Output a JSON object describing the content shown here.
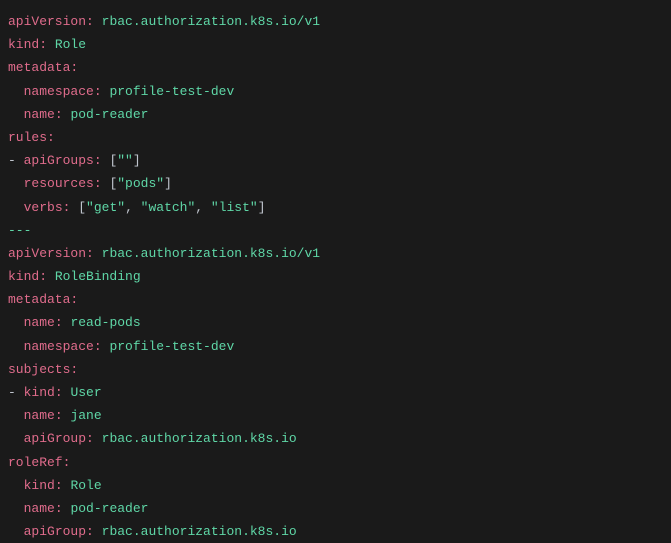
{
  "role": {
    "apiVersion_key": "apiVersion:",
    "apiVersion_val": "rbac.authorization.k8s.io/v1",
    "kind_key": "kind:",
    "kind_val": "Role",
    "metadata_key": "metadata:",
    "namespace_key": "namespace:",
    "namespace_val": "profile-test-dev",
    "name_key": "name:",
    "name_val": "pod-reader",
    "rules_key": "rules:",
    "apiGroups_key": "apiGroups:",
    "apiGroups_v0": "\"\"",
    "resources_key": "resources:",
    "resources_v0": "\"pods\"",
    "verbs_key": "verbs:",
    "verbs_v0": "\"get\"",
    "verbs_v1": "\"watch\"",
    "verbs_v2": "\"list\""
  },
  "sep": "---",
  "binding": {
    "apiVersion_key": "apiVersion:",
    "apiVersion_val": "rbac.authorization.k8s.io/v1",
    "kind_key": "kind:",
    "kind_val": "RoleBinding",
    "metadata_key": "metadata:",
    "name_key": "name:",
    "name_val": "read-pods",
    "namespace_key": "namespace:",
    "namespace_val": "profile-test-dev",
    "subjects_key": "subjects:",
    "subj_kind_key": "kind:",
    "subj_kind_val": "User",
    "subj_name_key": "name:",
    "subj_name_val": "jane",
    "subj_apiGroup_key": "apiGroup:",
    "subj_apiGroup_val": "rbac.authorization.k8s.io",
    "roleRef_key": "roleRef:",
    "rr_kind_key": "kind:",
    "rr_kind_val": "Role",
    "rr_name_key": "name:",
    "rr_name_val": "pod-reader",
    "rr_apiGroup_key": "apiGroup:",
    "rr_apiGroup_val": "rbac.authorization.k8s.io"
  }
}
